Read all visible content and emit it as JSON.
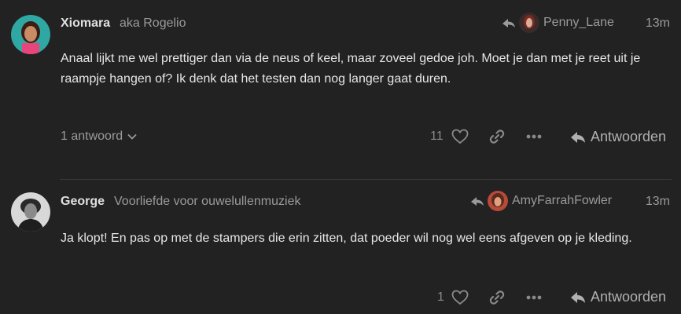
{
  "posts": [
    {
      "author": "Xiomara",
      "user_title": "aka Rogelio",
      "reply_to": "Penny_Lane",
      "time": "13m",
      "body": "Anaal lijkt me wel prettiger dan via de neus of keel, maar zoveel gedoe joh. Moet je dan met je reet uit je raampje hangen of? Ik denk dat het testen dan nog langer gaat duren.",
      "replies_label": "1 antwoord",
      "likes": "11",
      "reply_label": "Antwoorden"
    },
    {
      "author": "George",
      "user_title": "Voorliefde voor ouwelullenmuziek",
      "reply_to": "AmyFarrahFowler",
      "time": "13m",
      "body": "Ja klopt! En pas op met de stampers die erin zitten, dat poeder wil nog wel eens afgeven op je kleding.",
      "likes": "1",
      "reply_label": "Antwoorden"
    }
  ],
  "colors": {
    "background": "#222222",
    "text": "#e6e6e6",
    "muted": "#9a9a9a"
  }
}
